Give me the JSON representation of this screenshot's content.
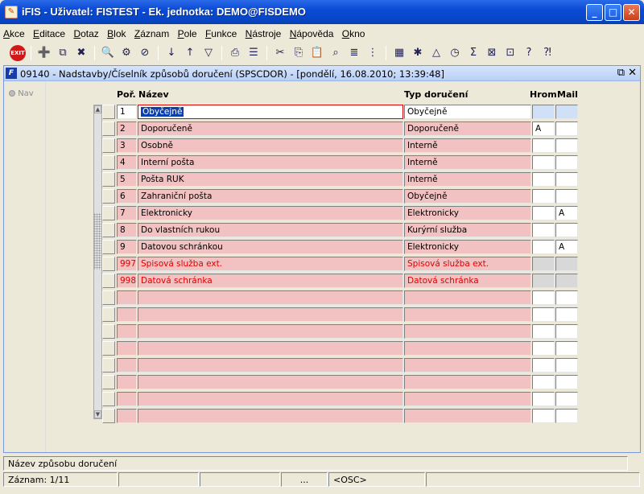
{
  "window": {
    "title": "iFIS - Uživatel: FISTEST - Ek. jednotka: DEMO@FISDEMO"
  },
  "menu": [
    "Akce",
    "Editace",
    "Dotaz",
    "Blok",
    "Záznam",
    "Pole",
    "Funkce",
    "Nástroje",
    "Nápověda",
    "Okno"
  ],
  "toolbar": {
    "exit_label": "EXIT"
  },
  "form": {
    "title": "09140 - Nadstavby/Číselník způsobů doručení (SPSCDOR) - [pondělí, 16.08.2010; 13:39:48]",
    "nav_label": "Nav"
  },
  "columns": {
    "por": "Poř.",
    "nazev": "Název",
    "typ": "Typ doručení",
    "hrom": "Hrom",
    "mail": "Mail"
  },
  "rows": [
    {
      "por": "1",
      "nazev": "Obyčejně",
      "typ": "Obyčejně",
      "hrom": "",
      "mail": "",
      "style": "current"
    },
    {
      "por": "2",
      "nazev": "Doporučeně",
      "typ": "Doporučeně",
      "hrom": "A",
      "mail": "",
      "style": "pink"
    },
    {
      "por": "3",
      "nazev": "Osobně",
      "typ": "Interně",
      "hrom": "",
      "mail": "",
      "style": "pink"
    },
    {
      "por": "4",
      "nazev": "Interní pošta",
      "typ": "Interně",
      "hrom": "",
      "mail": "",
      "style": "pink"
    },
    {
      "por": "5",
      "nazev": "Pošta RUK",
      "typ": "Interně",
      "hrom": "",
      "mail": "",
      "style": "pink"
    },
    {
      "por": "6",
      "nazev": "Zahraniční pošta",
      "typ": "Obyčejně",
      "hrom": "",
      "mail": "",
      "style": "pink"
    },
    {
      "por": "7",
      "nazev": "Elektronicky",
      "typ": "Elektronicky",
      "hrom": "",
      "mail": "A",
      "style": "pink"
    },
    {
      "por": "8",
      "nazev": "Do vlastních rukou",
      "typ": "Kurýrní služba",
      "hrom": "",
      "mail": "",
      "style": "pink"
    },
    {
      "por": "9",
      "nazev": "Datovou schránkou",
      "typ": "Elektronicky",
      "hrom": "",
      "mail": "A",
      "style": "pink"
    },
    {
      "por": "997",
      "nazev": "Spisová služba ext.",
      "typ": "Spisová služba ext.",
      "hrom": "",
      "mail": "",
      "style": "red"
    },
    {
      "por": "998",
      "nazev": "Datová schránka",
      "typ": "Datová schránka",
      "hrom": "",
      "mail": "",
      "style": "red"
    },
    {
      "por": "",
      "nazev": "",
      "typ": "",
      "hrom": "",
      "mail": "",
      "style": "pink"
    },
    {
      "por": "",
      "nazev": "",
      "typ": "",
      "hrom": "",
      "mail": "",
      "style": "pink"
    },
    {
      "por": "",
      "nazev": "",
      "typ": "",
      "hrom": "",
      "mail": "",
      "style": "pink"
    },
    {
      "por": "",
      "nazev": "",
      "typ": "",
      "hrom": "",
      "mail": "",
      "style": "pink"
    },
    {
      "por": "",
      "nazev": "",
      "typ": "",
      "hrom": "",
      "mail": "",
      "style": "pink"
    },
    {
      "por": "",
      "nazev": "",
      "typ": "",
      "hrom": "",
      "mail": "",
      "style": "pink"
    },
    {
      "por": "",
      "nazev": "",
      "typ": "",
      "hrom": "",
      "mail": "",
      "style": "pink"
    },
    {
      "por": "",
      "nazev": "",
      "typ": "",
      "hrom": "",
      "mail": "",
      "style": "pink"
    }
  ],
  "status": {
    "hint": "Název způsobu doručení",
    "record": "Záznam: 1/11",
    "dots": "...",
    "osc": "<OSC>"
  },
  "colors": {
    "row_pink": "#f2c1c1",
    "red_text": "#e00000",
    "titlebar": "#0a4ad6"
  }
}
